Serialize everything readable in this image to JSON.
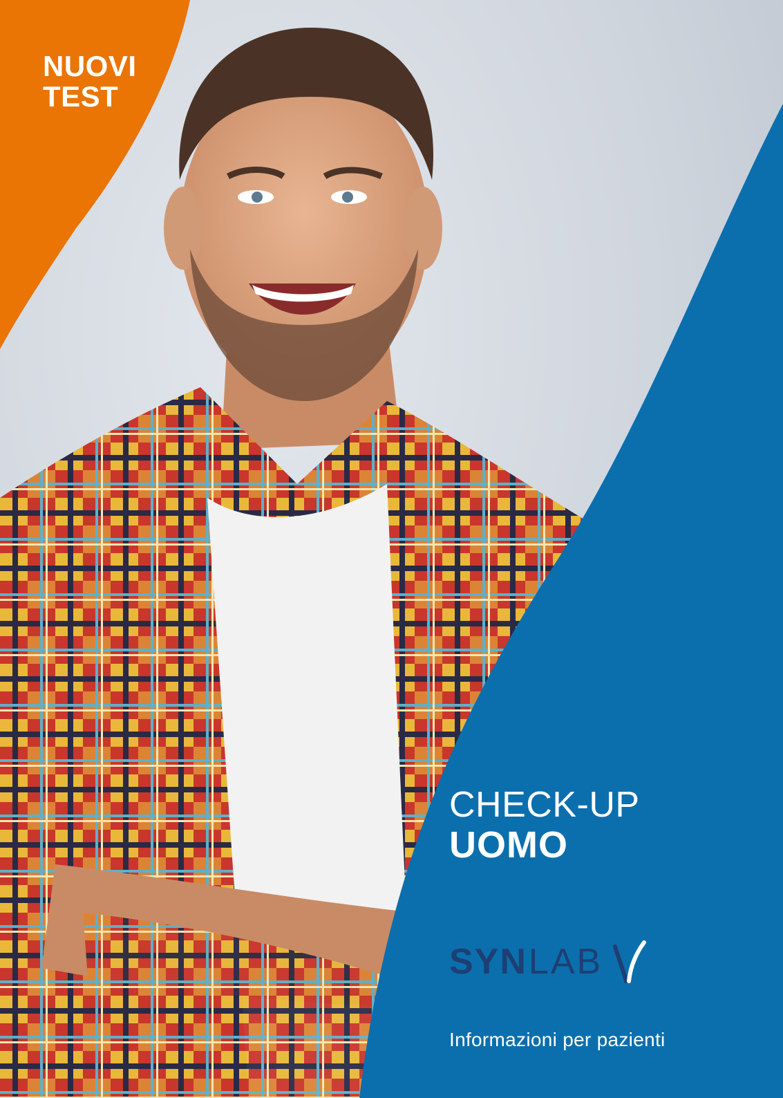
{
  "badge": {
    "line1": "NUOVI",
    "line2": "TEST"
  },
  "title": {
    "line1": "CHECK-UP",
    "line2": "UOMO"
  },
  "logo": {
    "syn": "SYN",
    "lab": "LAB"
  },
  "tagline": "Informazioni per pazienti",
  "colors": {
    "blue": "#0b6fae",
    "orange": "#ea7404",
    "navy": "#1e3f73"
  }
}
